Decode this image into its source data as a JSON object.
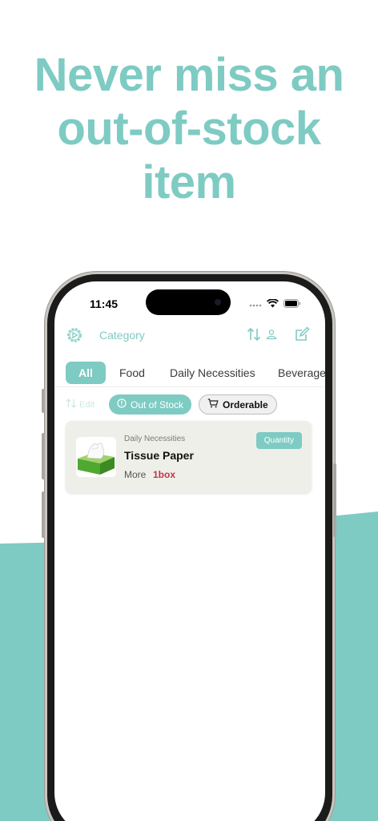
{
  "promo": {
    "headline": "Never miss an\nout-of-stock\nitem"
  },
  "colors": {
    "accent": "#7ecbc3",
    "alert": "#c2344a",
    "card_bg": "#efefea"
  },
  "status_bar": {
    "time": "11:45",
    "icons": [
      "signal-icon",
      "wifi-icon",
      "battery-icon"
    ]
  },
  "toolbar": {
    "settings_icon": "gear-icon",
    "category_label": "Category",
    "sort_icon": "sort-user-icon",
    "compose_icon": "compose-icon"
  },
  "tabs": [
    {
      "label": "All",
      "active": true
    },
    {
      "label": "Food",
      "active": false
    },
    {
      "label": "Daily Necessities",
      "active": false
    },
    {
      "label": "Beverage",
      "active": false
    }
  ],
  "filters": {
    "edit_label": "Edit",
    "out_of_stock_label": "Out of Stock",
    "orderable_label": "Orderable"
  },
  "items": [
    {
      "category": "Daily Necessities",
      "name": "Tissue Paper",
      "more_label": "More",
      "amount": "1box",
      "quantity_label": "Quantity",
      "icon": "tissue-box-icon"
    }
  ]
}
